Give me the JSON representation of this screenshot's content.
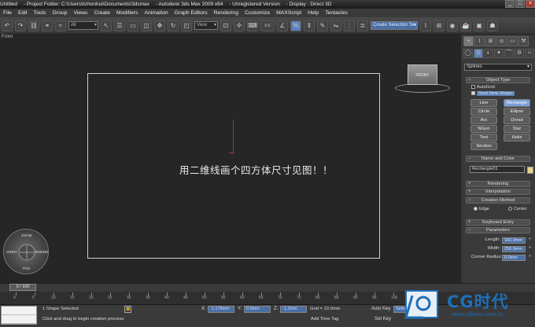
{
  "window": {
    "title_parts": [
      "Untitled",
      "- Project Folder: C:\\Users\\lizhonhui\\Documents\\3dsmax",
      "- Autodesk 3ds Max  2009 x64",
      "- Unregistered Version",
      "- Display : Direct 3D"
    ],
    "controls": [
      "_",
      "□",
      "×"
    ]
  },
  "menu": {
    "items": [
      "File",
      "Edit",
      "Tools",
      "Group",
      "Views",
      "Create",
      "Modifiers",
      "Animation",
      "Graph Editors",
      "Rendering",
      "Customize",
      "MAXScript",
      "Help",
      "Tentacles"
    ]
  },
  "toolbar": {
    "selection_filter": "All",
    "ref_coord": "View",
    "numeric_label": "0.0",
    "named_selection": "Create Selection Se"
  },
  "viewport": {
    "label": "Front",
    "caption": "用二维线画个四方体尺寸见图！！",
    "viewcube_label": "FRONT",
    "steering": {
      "top": "ZOOM",
      "bottom": "PAN",
      "left": "ORBIT",
      "right": "REWIND"
    }
  },
  "command_panel": {
    "tabs": [
      "+",
      "⌇",
      "⊞",
      "◎",
      "▭",
      "⚒"
    ],
    "category_icons": [
      "◯",
      "☰",
      "◐",
      "✦",
      "⌒",
      "⚙",
      "≈"
    ],
    "category_dropdown": "Splines",
    "object_type": {
      "header": "Object Type",
      "autogrid": "AutoGrid",
      "start_new_shape": "Start New Shape",
      "buttons": [
        "Line",
        "Rectangle",
        "Circle",
        "Ellipse",
        "Arc",
        "Donut",
        "NGon",
        "Star",
        "Text",
        "Helix",
        "Section"
      ],
      "active_button": "Rectangle"
    },
    "name_and_color": {
      "header": "Name and Color",
      "name": "Rectangle01",
      "swatch_color": "#e6d38c"
    },
    "rollouts_collapsed": [
      "Rendering",
      "Interpolation"
    ],
    "creation_method": {
      "header": "Creation Method",
      "options": [
        "Edge",
        "Center"
      ],
      "selected": "Edge"
    },
    "keyboard_entry": "Keyboard Entry",
    "parameters": {
      "header": "Parameters",
      "fields": [
        {
          "label": "Length:",
          "value": "160.0mm"
        },
        {
          "label": "Width:",
          "value": "250.0mm"
        },
        {
          "label": "Corner Radius:",
          "value": "0.0mm"
        }
      ]
    }
  },
  "timeline": {
    "slider": "0 / 100",
    "ticks": [
      "0",
      "5",
      "10",
      "15",
      "20",
      "25",
      "30",
      "35",
      "40",
      "45",
      "50",
      "55",
      "60",
      "65",
      "70",
      "75",
      "80",
      "85",
      "90",
      "95",
      "100"
    ]
  },
  "status": {
    "selection": "1 Shape Selected",
    "prompt": "Click and drag to begin creation process",
    "x_label": "X:",
    "x_value": "-1.179mm",
    "y_label": "Y:",
    "y_value": "0.0mm",
    "z_label": "Z:",
    "z_value": "-1.2mm",
    "grid": "Grid = 10.0mm",
    "add_time_tag": "Add Time Tag",
    "auto_key": "Auto Key",
    "set_key": "Set Key",
    "key_filter": "Selected"
  },
  "watermark": {
    "brand": "CG时代",
    "url": "www.cgtimes.com.cn"
  }
}
